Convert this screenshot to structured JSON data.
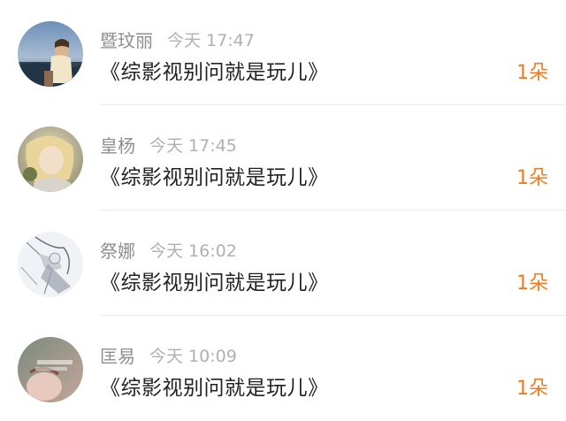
{
  "items": [
    {
      "avatar": "avatar-person-on-rock-by-sea",
      "name": "暨玟丽",
      "time": "今天 17:47",
      "title": "《综影视别问就是玩儿》",
      "count": "1朵"
    },
    {
      "avatar": "avatar-girl-blonde-hair",
      "name": "皇杨",
      "time": "今天 17:45",
      "title": "《综影视别问就是玩儿》",
      "count": "1朵"
    },
    {
      "avatar": "avatar-anime-sketch",
      "name": "祭娜",
      "time": "今天 16:02",
      "title": "《综影视别问就是玩儿》",
      "count": "1朵"
    },
    {
      "avatar": "avatar-photo-with-caption",
      "name": "匡易",
      "time": "今天 10:09",
      "title": "《综影视别问就是玩儿》",
      "count": "1朵"
    }
  ],
  "colors": {
    "name": "#8e8e8e",
    "time": "#b0b0b0",
    "title": "#222222",
    "count": "#f07c22",
    "divider": "#ececec"
  }
}
